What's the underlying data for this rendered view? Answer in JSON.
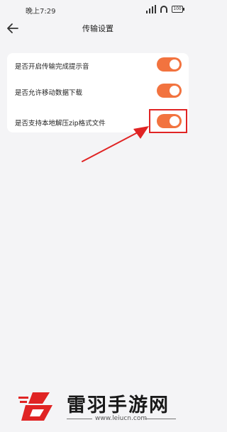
{
  "status_bar": {
    "time": "晚上7:29",
    "battery": "100"
  },
  "header": {
    "title": "传输设置"
  },
  "settings": [
    {
      "label": "是否开启传输完成提示音",
      "enabled": true
    },
    {
      "label": "是否允许移动数据下载",
      "enabled": true
    },
    {
      "label": "是否支持本地解压zip格式文件",
      "enabled": true
    }
  ],
  "watermark": {
    "brand": "雷羽手游网",
    "url": "www.leiucn.com"
  },
  "colors": {
    "toggle_on": "#f2733f",
    "highlight": "#e02424",
    "background": "#f4f4f6"
  }
}
